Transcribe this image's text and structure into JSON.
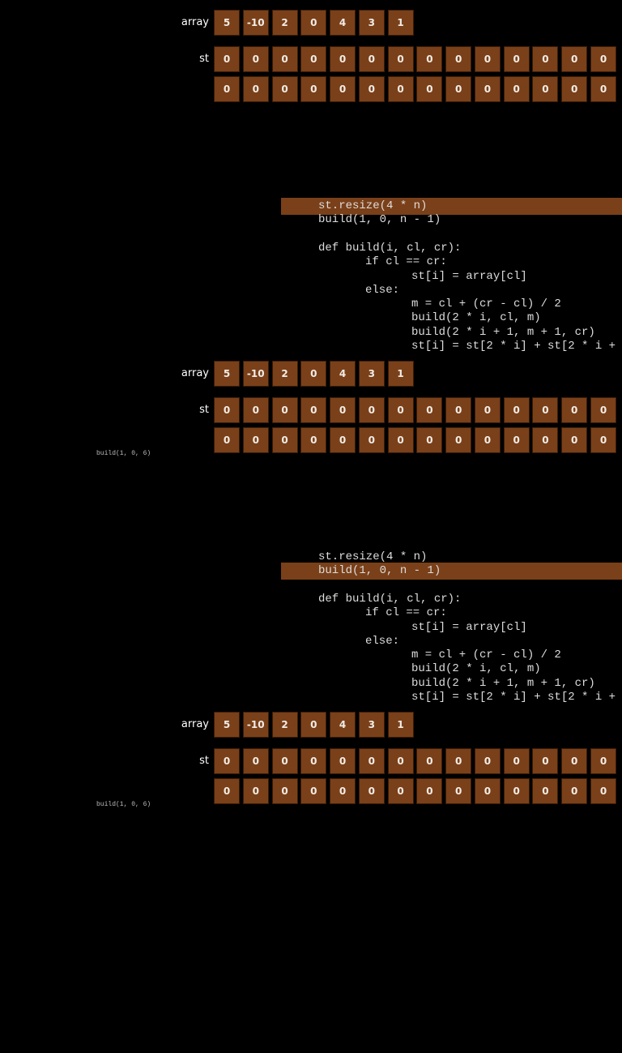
{
  "labels": {
    "array": "array",
    "st": "st"
  },
  "colors": {
    "cell": "#7a4019",
    "highlight": "#7a4019",
    "background": "#000000"
  },
  "array": [
    "5",
    "-10",
    "2",
    "0",
    "4",
    "3",
    "1"
  ],
  "st_row1": [
    "0",
    "0",
    "0",
    "0",
    "0",
    "0",
    "0",
    "0",
    "0",
    "0",
    "0",
    "0",
    "0",
    "0"
  ],
  "st_row2": [
    "0",
    "0",
    "0",
    "0",
    "0",
    "0",
    "0",
    "0",
    "0",
    "0",
    "0",
    "0",
    "0",
    "0"
  ],
  "code": [
    {
      "text": "st.resize(4 * n)",
      "indent": 0
    },
    {
      "text": "build(1, 0, n - 1)",
      "indent": 0
    },
    {
      "text": "",
      "indent": 0
    },
    {
      "text": "def build(i, cl, cr):",
      "indent": 0
    },
    {
      "text": "if cl == cr:",
      "indent": 1
    },
    {
      "text": "st[i] = array[cl]",
      "indent": 2
    },
    {
      "text": "else:",
      "indent": 1
    },
    {
      "text": "m = cl + (cr - cl) / 2",
      "indent": 2
    },
    {
      "text": "build(2 * i, cl, m)",
      "indent": 2
    },
    {
      "text": "build(2 * i + 1, m + 1, cr)",
      "indent": 2
    },
    {
      "text": "st[i] = st[2 * i] + st[2 * i +",
      "indent": 2
    }
  ],
  "frames": [
    {
      "show_code": false,
      "highlight_line": null,
      "call_label": null
    },
    {
      "show_code": true,
      "highlight_line": 0,
      "call_label": "build(1, 0, 6)"
    },
    {
      "show_code": true,
      "highlight_line": 1,
      "call_label": "build(1, 0, 6)"
    }
  ]
}
